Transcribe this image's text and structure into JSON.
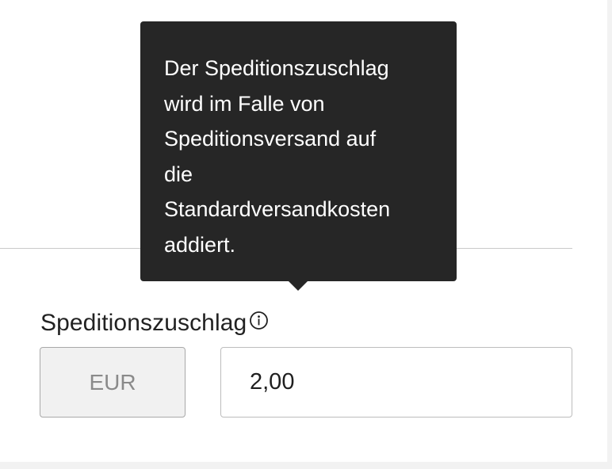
{
  "tooltip": {
    "text": "Der Speditionszuschlag\nwird im Falle von\nSpeditionsversand auf\ndie\nStandardversandkosten\naddiert."
  },
  "field": {
    "label": "Speditionszuschlag",
    "info_icon": "info-circle-icon",
    "currency": "EUR",
    "value": "2,00"
  },
  "colors": {
    "tooltip_background": "#262626",
    "tooltip_text": "#ffffff",
    "currency_box_background": "#f1f1f1",
    "page_background": "#f2f2f2"
  }
}
